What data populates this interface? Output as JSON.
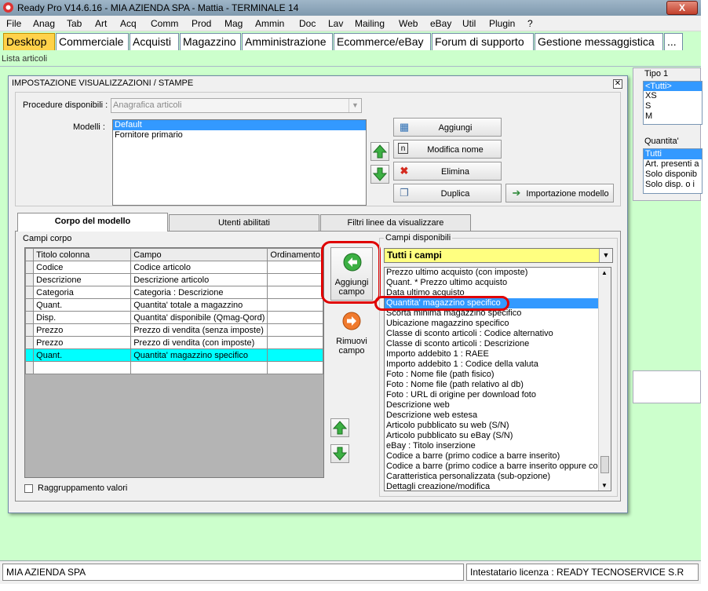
{
  "window": {
    "title": "Ready Pro V14.6.16 - MIA AZIENDA SPA - Mattia - TERMINALE 14",
    "close": "X"
  },
  "menu": [
    "File",
    "Anag",
    "Tab",
    "Art",
    "Acq",
    "Comm",
    "Prod",
    "Mag",
    "Ammin",
    "Doc",
    "Lav",
    "Mailing",
    "Web",
    "eBay",
    "Util",
    "Plugin",
    "?"
  ],
  "tabs": [
    "Desktop",
    "Commerciale",
    "Acquisti",
    "Magazzino",
    "Amministrazione",
    "Ecommerce/eBay",
    "Forum di supporto",
    "Gestione messaggistica",
    "..."
  ],
  "page_label": "Lista articoli",
  "right_panel": {
    "tipo_label": "Tipo 1",
    "tipo_items": [
      "<Tutti>",
      "XS",
      "S",
      "M"
    ],
    "quantita_label": "Quantita'",
    "quantita_items": [
      "Tutti",
      "Art. presenti a",
      "Solo disponib",
      "Solo disp. o i"
    ]
  },
  "dialog": {
    "title": "IMPOSTAZIONE VISUALIZZAZIONI / STAMPE",
    "procedure_label": "Procedure disponibili :",
    "procedure_value": "Anagrafica articoli",
    "modelli_label": "Modelli :",
    "modelli": [
      "Default",
      "Fornitore primario"
    ],
    "btn_aggiungi": "Aggiungi",
    "btn_modifica": "Modifica nome",
    "btn_elimina": "Elimina",
    "btn_duplica": "Duplica",
    "btn_importazione": "Importazione modello",
    "tabs": [
      "Corpo del modello",
      "Utenti abilitati",
      "Filtri linee da visualizzare"
    ],
    "campi_corpo_label": "Campi corpo",
    "grid_headers": [
      "Titolo colonna",
      "Campo",
      "Ordinamento"
    ],
    "grid_rows": [
      [
        "Codice",
        "Codice articolo",
        ""
      ],
      [
        "Descrizione",
        "Descrizione articolo",
        ""
      ],
      [
        "Categoria",
        "Categoria : Descrizione",
        ""
      ],
      [
        "Quant.",
        "Quantita' totale a magazzino",
        ""
      ],
      [
        "Disp.",
        "Quantita' disponibile (Qmag-Qord)",
        ""
      ],
      [
        "Prezzo",
        "Prezzo di vendita (senza imposte)",
        ""
      ],
      [
        "Prezzo",
        "Prezzo di vendita (con imposte)",
        ""
      ],
      [
        "Quant.",
        "Quantita' magazzino specifico",
        ""
      ],
      [
        "",
        "",
        ""
      ]
    ],
    "aggiungi_campo": [
      "Aggiungi",
      "campo"
    ],
    "rimuovi_campo": [
      "Rimuovi",
      "campo"
    ],
    "raggruppamento": "Raggruppamento valori",
    "campi_disponibili_label": "Campi disponibili",
    "campi_filter": "Tutti i campi",
    "campi_list": [
      "Prezzo ultimo acquisto (con imposte)",
      "Quant. * Prezzo ultimo acquisto",
      "Data ultimo acquisto",
      "Quantita' magazzino specifico",
      "Scorta minima magazzino specifico",
      "Ubicazione magazzino specifico",
      "Classe di sconto articoli : Codice alternativo",
      "Classe di sconto articoli : Descrizione",
      "Importo addebito 1 : RAEE",
      "Importo addebito 1 : Codice della valuta",
      "Foto : Nome file (path fisico)",
      "Foto : Nome file (path relativo al db)",
      "Foto : URL di origine per download foto",
      "Descrizione web",
      "Descrizione web estesa",
      "Articolo pubblicato su web (S/N)",
      "Articolo pubblicato su eBay (S/N)",
      "eBay : Titolo inserzione",
      "Codice a barre (primo codice a barre inserito)",
      "Codice a barre (primo codice a barre inserito oppure codic",
      "Caratteristica personalizzata (sub-opzione)",
      "Dettagli creazione/modifica"
    ]
  },
  "status": {
    "company": "MIA AZIENDA SPA",
    "license": "Intestatario licenza : READY TECNOSERVICE S.R"
  },
  "colors": {
    "accent_tab": "#ffd24a",
    "selection": "#3399ff",
    "grid_highlight": "#00ffff",
    "background": "#ccffcc",
    "highlight_ring": "#e00000"
  }
}
